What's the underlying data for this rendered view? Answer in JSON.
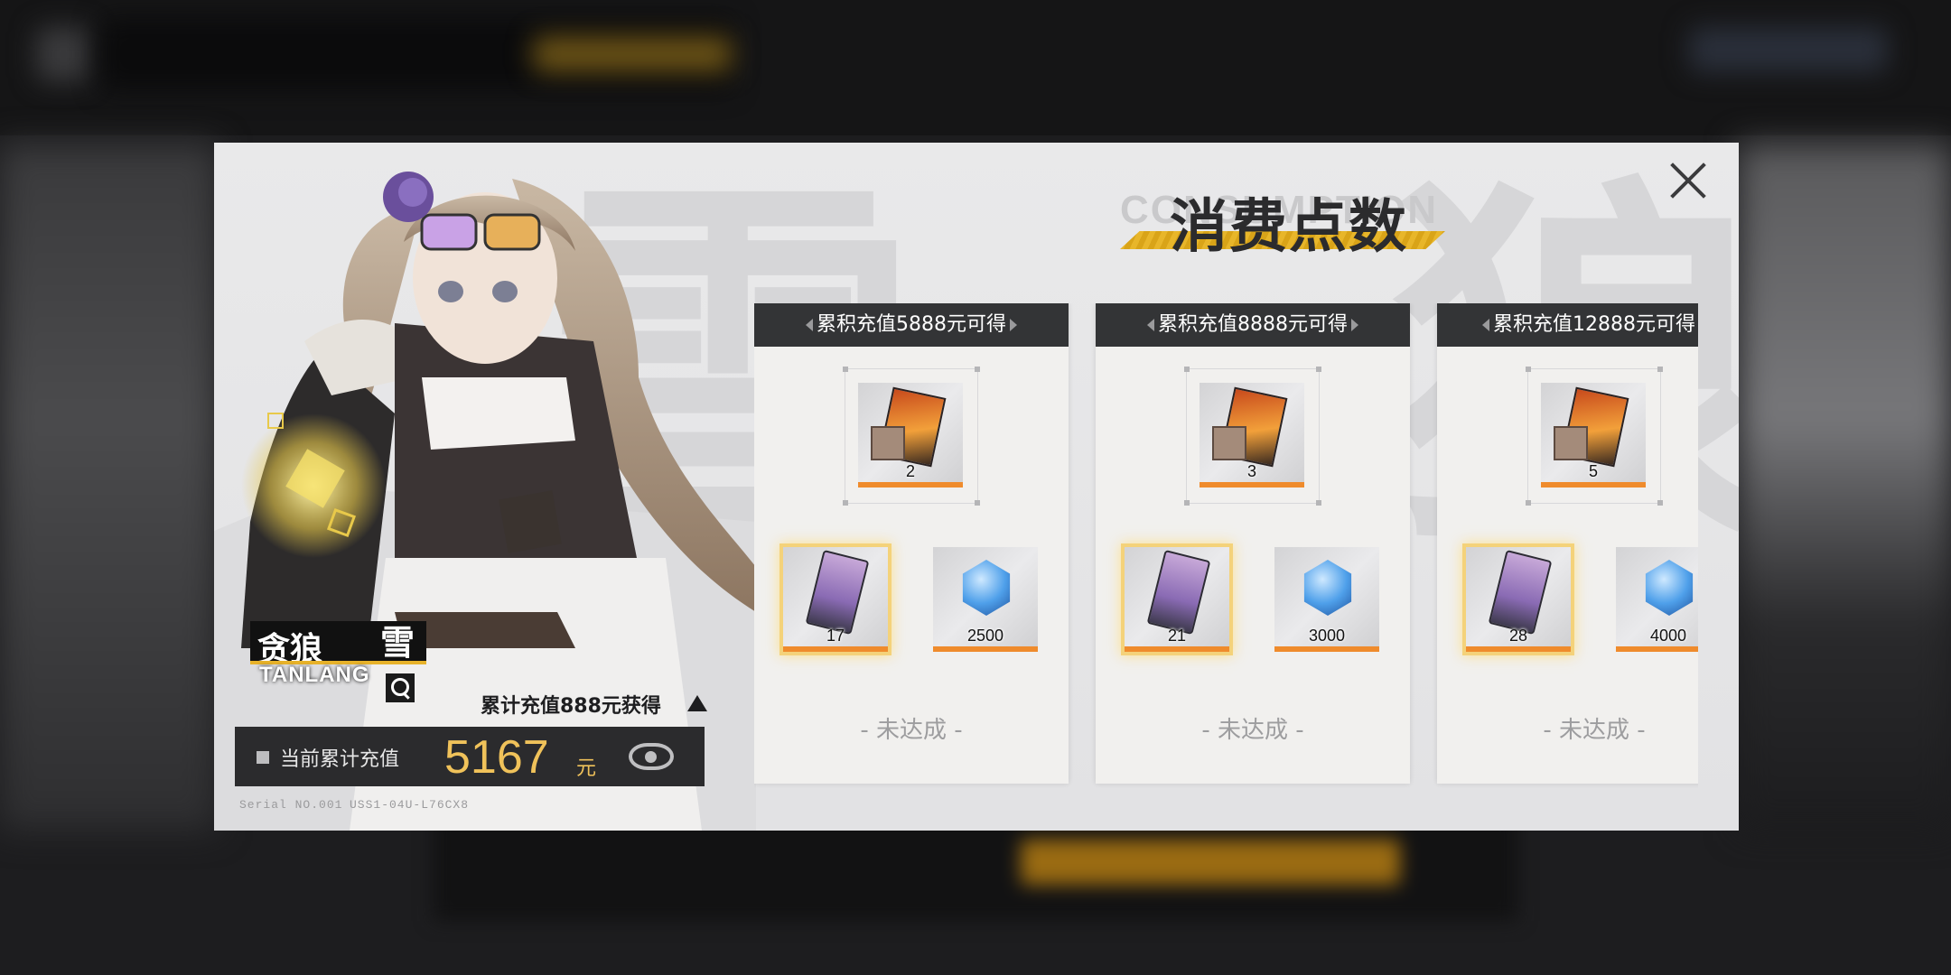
{
  "modal": {
    "title": "消费点数",
    "title_ghost": "CONSUMPTION",
    "close_label": "×"
  },
  "character": {
    "name_cn": "贪狼",
    "name_glyph": "雪",
    "name_en": "TANLANG",
    "bonus_text": "累计充值888元获得",
    "current_label": "当前累计充值",
    "current_value": "5167",
    "current_unit": "元",
    "serial": "Serial NO.001",
    "code": "USS1-04U-L76CX8"
  },
  "cards": [
    {
      "header": "累积充值5888元可得",
      "items": [
        {
          "icon": "character-selector-icon",
          "qty": "2"
        },
        {
          "icon": "recruit-ticket-icon",
          "qty": "17"
        },
        {
          "icon": "blue-crystal-icon",
          "qty": "2500"
        }
      ],
      "status": "- 未达成 -"
    },
    {
      "header": "累积充值8888元可得",
      "items": [
        {
          "icon": "character-selector-icon",
          "qty": "3"
        },
        {
          "icon": "recruit-ticket-icon",
          "qty": "21"
        },
        {
          "icon": "blue-crystal-icon",
          "qty": "3000"
        }
      ],
      "status": "- 未达成 -"
    },
    {
      "header": "累积充值12888元可得",
      "items": [
        {
          "icon": "character-selector-icon",
          "qty": "5"
        },
        {
          "icon": "recruit-ticket-icon",
          "qty": "28"
        },
        {
          "icon": "blue-crystal-icon",
          "qty": "4000"
        }
      ],
      "status": "- 未达成 -"
    }
  ],
  "colors": {
    "accent_gold": "#e7b22a",
    "value_gold": "#f0c25a",
    "item_underline": "#ef8b2c",
    "card_header": "#333436"
  }
}
